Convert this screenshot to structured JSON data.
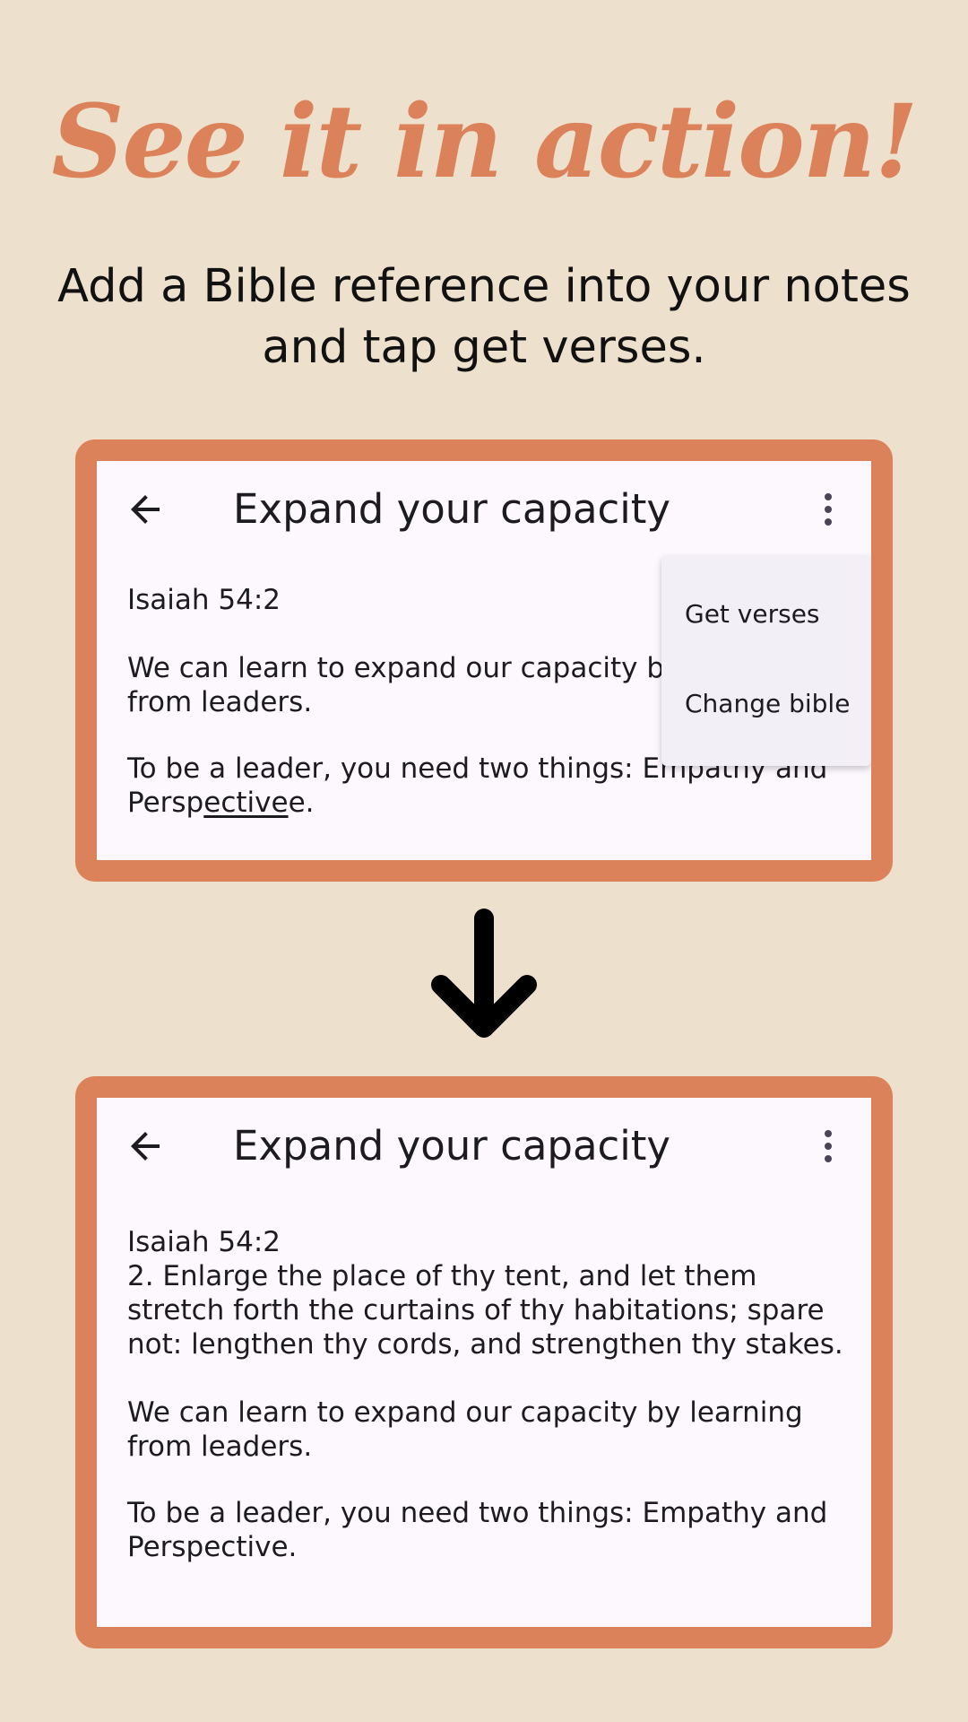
{
  "headline": "See it in action!",
  "subhead": "Add a Bible reference into your notes and tap get verses.",
  "colors": {
    "background": "#ede0cc",
    "accent": "#dc825a",
    "screen": "#fdf8fe",
    "menu": "#f2eff6"
  },
  "before": {
    "title": "Expand your capacity",
    "back_icon": "arrow-back-icon",
    "more_icon": "more-vert-icon",
    "reference": "Isaiah 54:2",
    "para1": "We can learn to expand our capacity by learning from leaders.",
    "para2_start": "To be a leader, you need two things: Empathy and Persp",
    "para2_underlined": "ective",
    "para2_end": "e.",
    "menu": {
      "item1": "Get verses",
      "item2": "Change bible"
    }
  },
  "transition_icon": "arrow-down-icon",
  "after": {
    "title": "Expand your capacity",
    "back_icon": "arrow-back-icon",
    "more_icon": "more-vert-icon",
    "reference": "Isaiah 54:2",
    "verse": "2. Enlarge the place of thy tent, and let them stretch forth the curtains of thy habitations; spare not: lengthen thy cords, and strengthen thy stakes.",
    "para1": "We can learn to expand our capacity by learning from leaders.",
    "para2": "To be a leader, you need two things: Empathy and Perspective."
  }
}
